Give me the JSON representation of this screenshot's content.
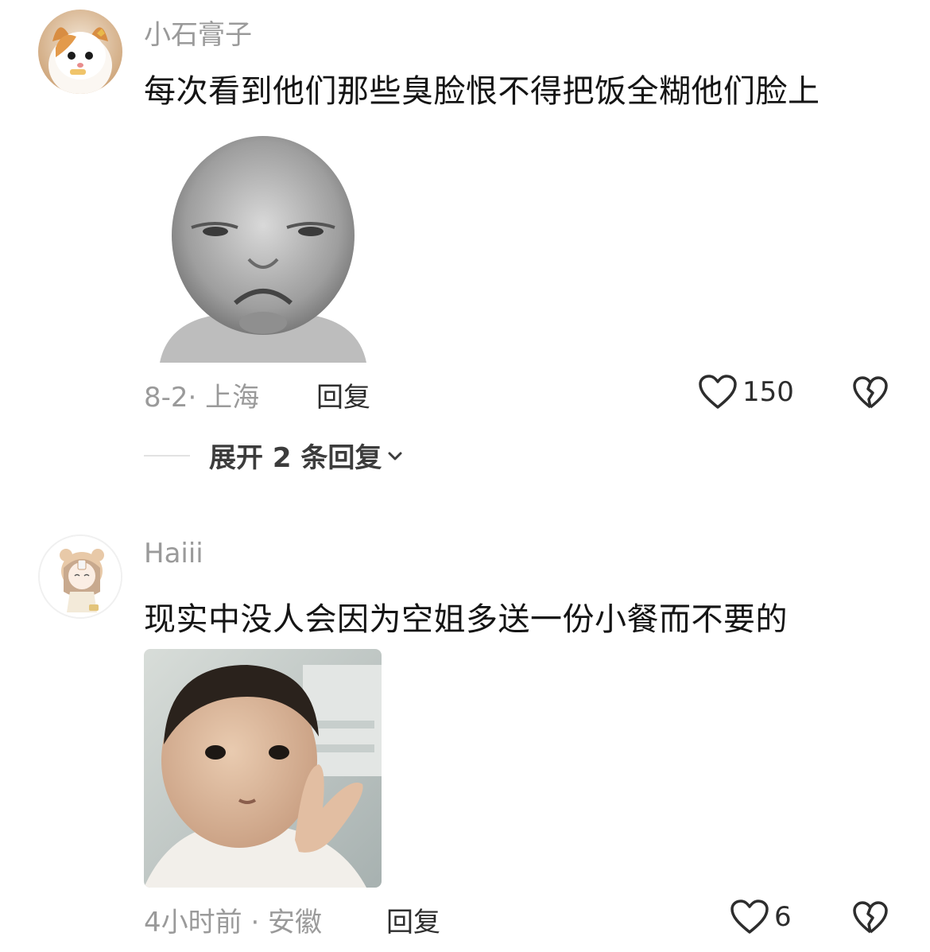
{
  "comments": [
    {
      "username": "小石膏子",
      "text": "每次看到他们那些臭脸恨不得把饭全糊他们脸上",
      "time_location": "8-2· 上海",
      "reply_label": "回复",
      "likes": "150",
      "avatar_icon": "cat-avatar",
      "attachment": "grumpy-baby-meme"
    },
    {
      "username": "Haiii",
      "text": "现实中没人会因为空姐多送一份小餐而不要的",
      "time_location": "4小时前 · 安徽",
      "reply_label": "回复",
      "likes": "6",
      "avatar_icon": "anime-girl-avatar",
      "attachment": "toddler-peace-sign-photo"
    }
  ],
  "expand_replies": {
    "label": "展开 2 条回复"
  },
  "icons": {
    "like": "heart-outline-icon",
    "dislike": "broken-heart-icon",
    "expand": "chevron-down-icon"
  },
  "colors": {
    "text_primary": "#141414",
    "text_secondary": "#9a9a9a",
    "action_text": "#2d2d2d",
    "divider": "#e2e2e2"
  }
}
